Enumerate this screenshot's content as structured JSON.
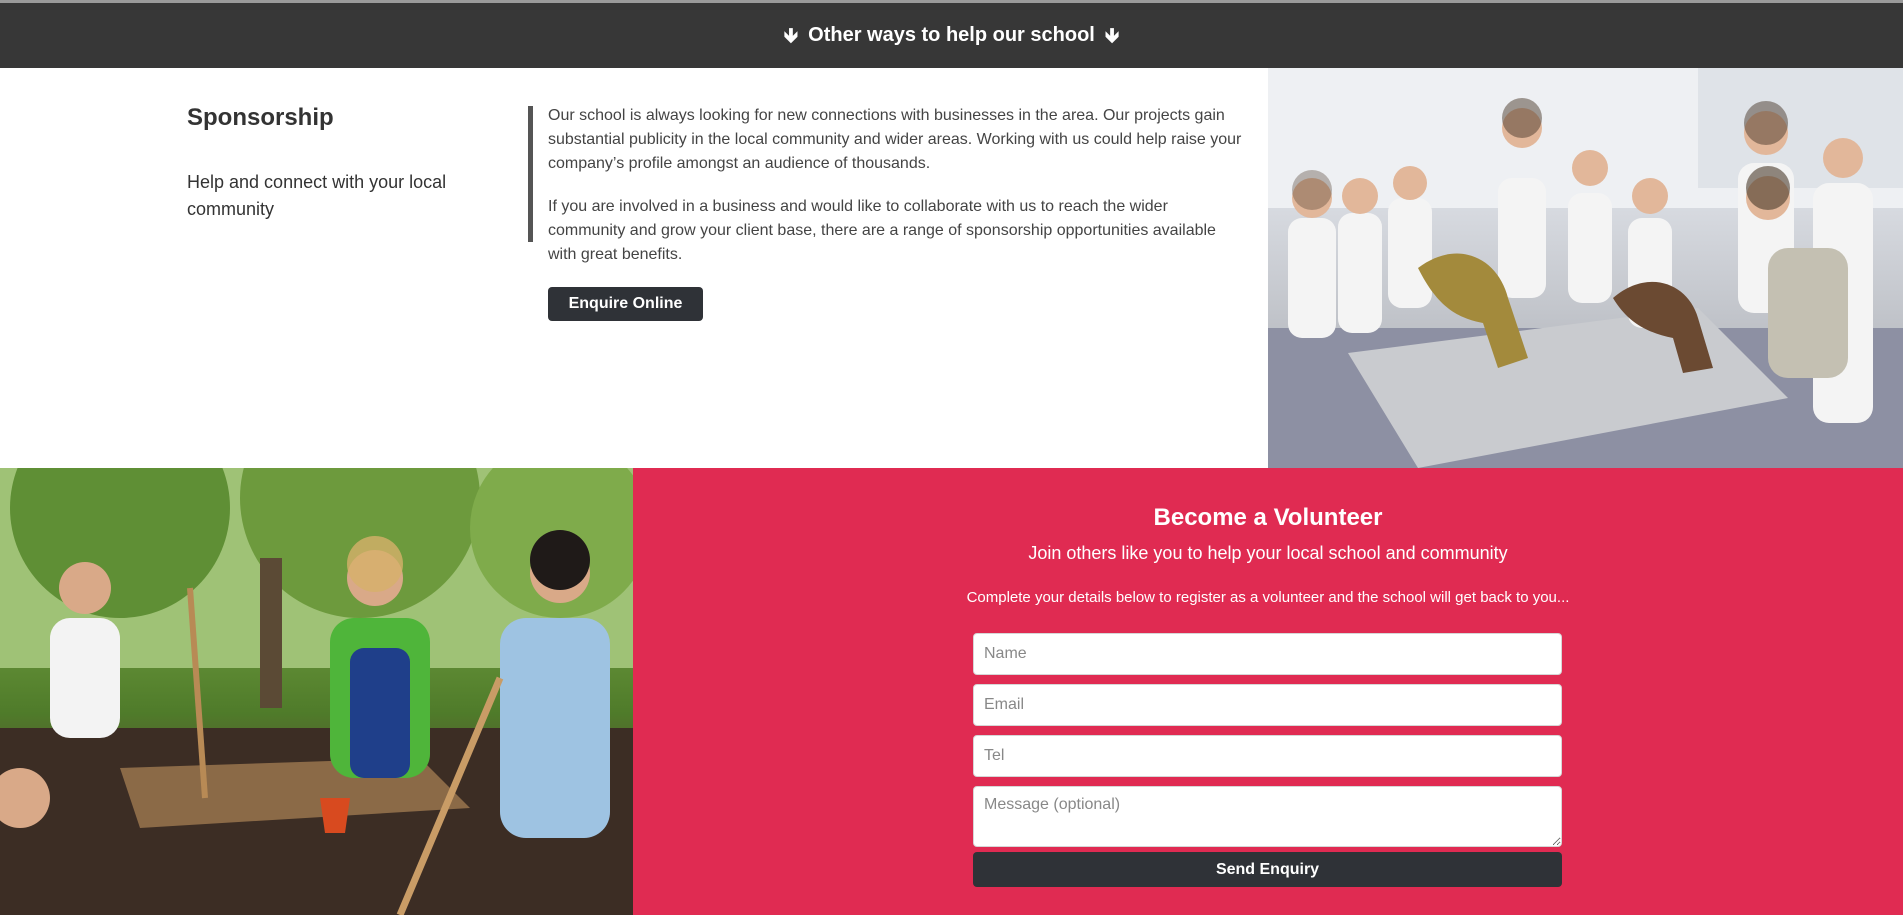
{
  "banner": {
    "arrow_left": "🡻",
    "title": "Other ways to help our school",
    "arrow_right": "🡻"
  },
  "sponsorship": {
    "title": "Sponsorship",
    "subtitle": "Help and connect with your local community",
    "paragraph1": "Our school is always looking for new connections with businesses in the area. Our projects gain substantial publicity in the local community and wider areas. Working with us could help raise your company’s profile amongst an audience of thousands.",
    "paragraph2": "If you are involved in a business and would like to collaborate with us to reach the wider community and grow your client base, there are a range of sponsorship opportunities available with great benefits.",
    "button_label": "Enquire Online"
  },
  "volunteer": {
    "title": "Become a Volunteer",
    "subtitle": "Join others like you to help your local school and community",
    "note": "Complete your details below to register as a volunteer and the school will get back to you...",
    "name_placeholder": "Name",
    "email_placeholder": "Email",
    "tel_placeholder": "Tel",
    "message_placeholder": "Message (optional)",
    "button_label": "Send Enquiry"
  },
  "colors": {
    "banner_bg": "#373737",
    "volunteer_bg": "#e02b52",
    "button_bg": "#2f3237"
  },
  "images": {
    "classroom_photo": "children-and-teachers-with-dinosaur-models-photo",
    "garden_photo": "children-gardening-with-teacher-photo"
  }
}
